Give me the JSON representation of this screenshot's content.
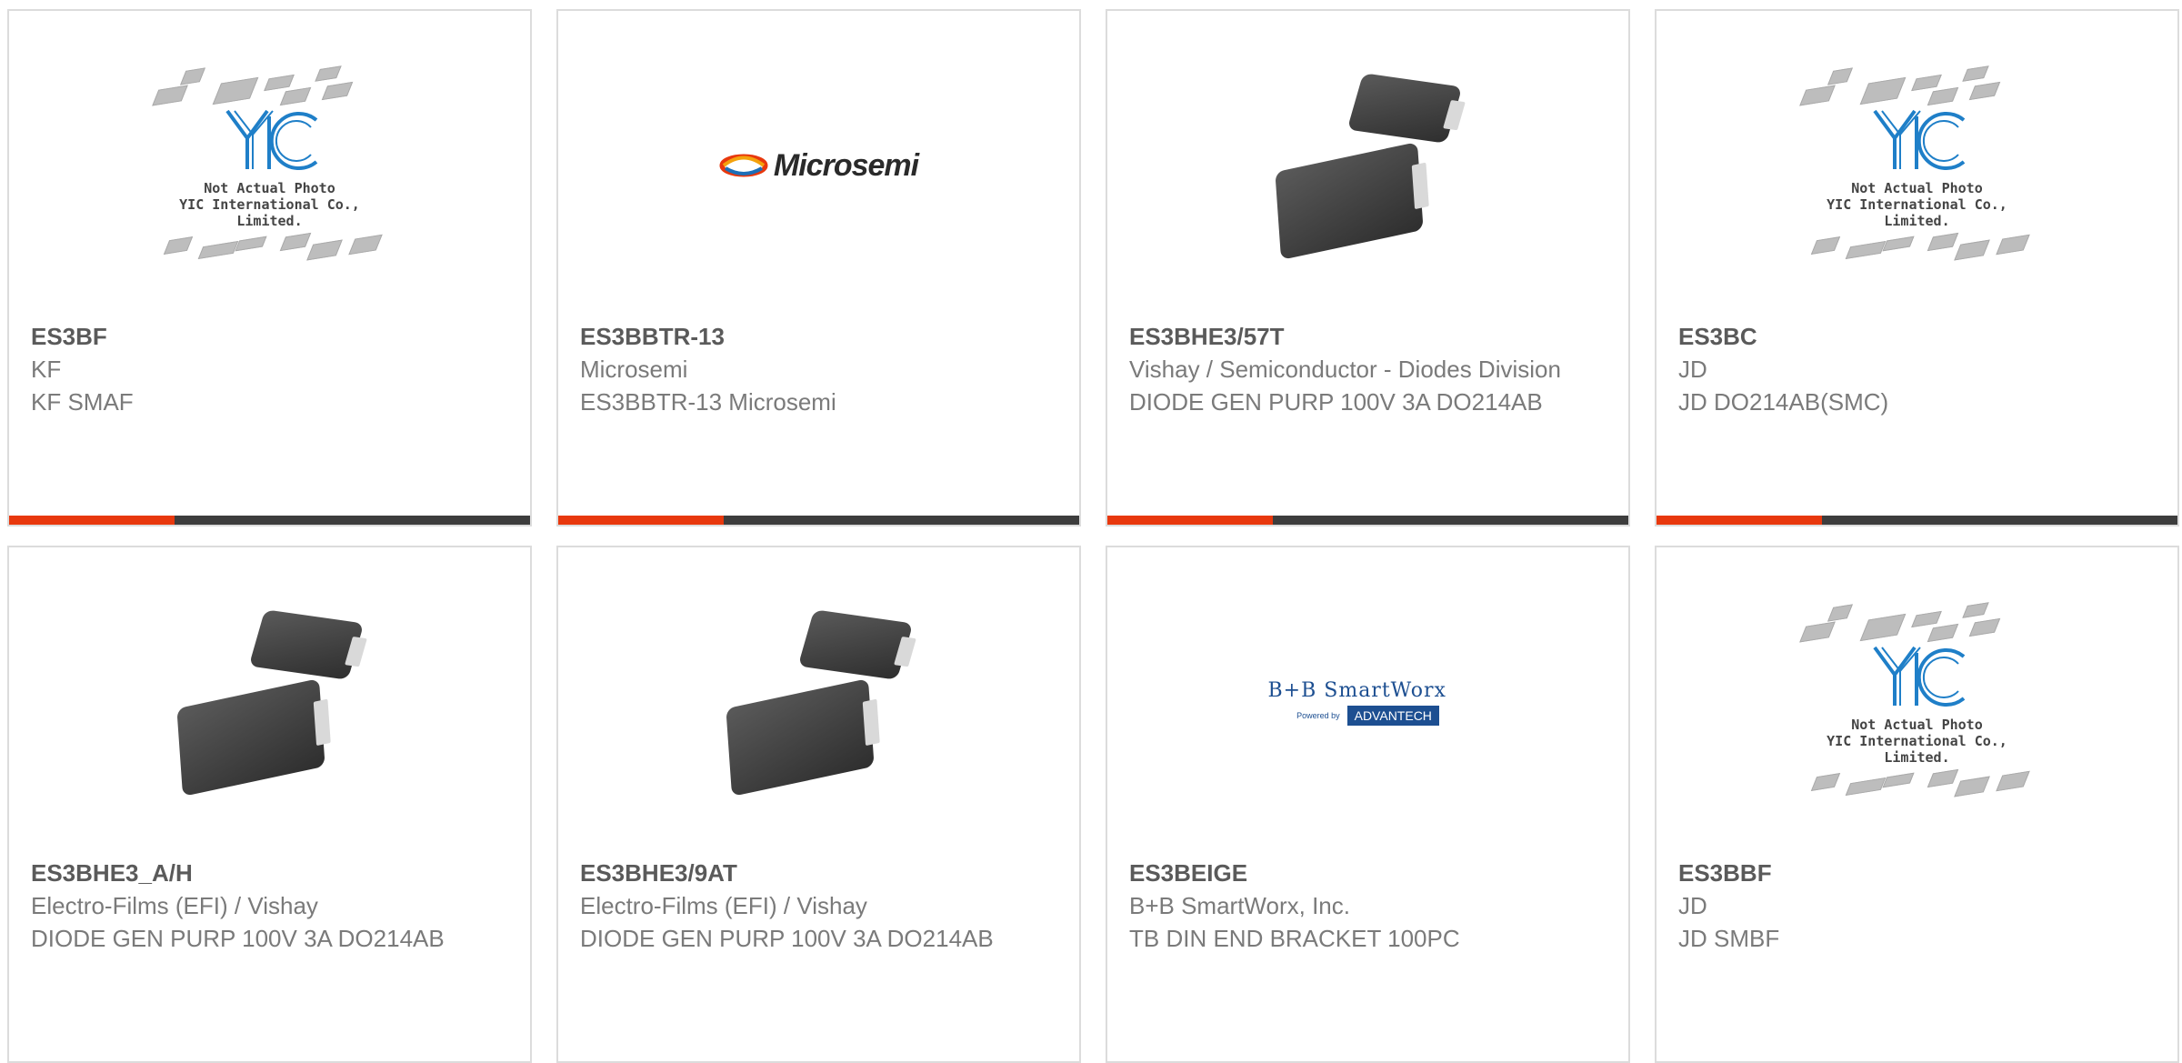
{
  "products": [
    {
      "part": "ES3BF",
      "manufacturer": "KF",
      "description": "KF SMAF",
      "image": "yic-placeholder",
      "image_text": [
        "Not Actual Photo",
        "YIC International Co., Limited."
      ]
    },
    {
      "part": "ES3BBTR-13",
      "manufacturer": "Microsemi",
      "description": "ES3BBTR-13 Microsemi",
      "image": "microsemi-logo",
      "logo_text": "Microsemi"
    },
    {
      "part": "ES3BHE3/57T",
      "manufacturer": "Vishay / Semiconductor - Diodes Division",
      "description": "DIODE GEN PURP 100V 3A DO214AB",
      "image": "diode-photo"
    },
    {
      "part": "ES3BC",
      "manufacturer": "JD",
      "description": "JD DO214AB(SMC)",
      "image": "yic-placeholder",
      "image_text": [
        "Not Actual Photo",
        "YIC International Co., Limited."
      ]
    },
    {
      "part": "ES3BHE3_A/H",
      "manufacturer": "Electro-Films (EFI) / Vishay",
      "description": "DIODE GEN PURP 100V 3A DO214AB",
      "image": "diode-photo"
    },
    {
      "part": "ES3BHE3/9AT",
      "manufacturer": "Electro-Films (EFI) / Vishay",
      "description": "DIODE GEN PURP 100V 3A DO214AB",
      "image": "diode-photo"
    },
    {
      "part": "ES3BEIGE",
      "manufacturer": "B+B SmartWorx, Inc.",
      "description": "TB DIN END BRACKET 100PC",
      "image": "bb-smartworx-logo",
      "logo_text": "B+B SmartWorx",
      "logo_sub": "Powered by",
      "logo_brand": "ADVANTECH"
    },
    {
      "part": "ES3BBF",
      "manufacturer": "JD",
      "description": "JD SMBF",
      "image": "yic-placeholder",
      "image_text": [
        "Not Actual Photo",
        "YIC International Co., Limited."
      ]
    }
  ],
  "colors": {
    "accent": "#e8380d",
    "bar": "#3d3d3d",
    "border": "#dcdcdc",
    "text": "#7a7a7a",
    "title": "#5a5a5a"
  }
}
